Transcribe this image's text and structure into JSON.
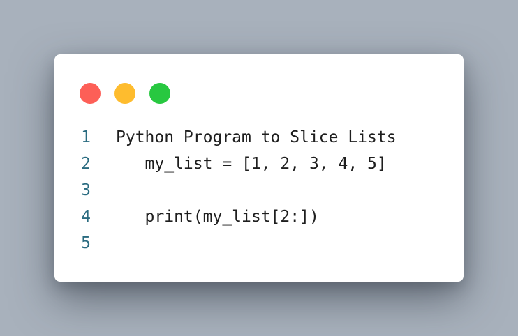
{
  "window": {
    "controls": {
      "close_color": "#fd5f57",
      "minimize_color": "#febc2e",
      "maximize_color": "#28c840"
    }
  },
  "code": {
    "lines": [
      {
        "number": "1",
        "text": "Python Program to Slice Lists"
      },
      {
        "number": "2",
        "text": "   my_list = [1, 2, 3, 4, 5]"
      },
      {
        "number": "3",
        "text": ""
      },
      {
        "number": "4",
        "text": "   print(my_list[2:])"
      },
      {
        "number": "5",
        "text": ""
      }
    ]
  }
}
